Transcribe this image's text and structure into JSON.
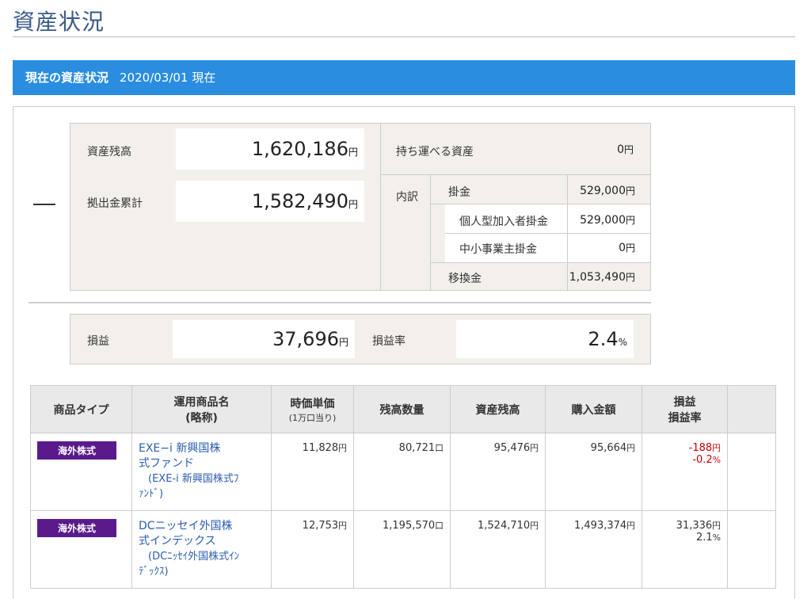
{
  "page_title": "資産状況",
  "section": {
    "title": "現在の資産状況",
    "date": "2020/03/01 現在"
  },
  "summary": {
    "collapse_icon": "minus-icon",
    "asset_balance": {
      "label": "資産残高",
      "value": "1,620,186",
      "unit": "円"
    },
    "contribution_total": {
      "label": "拠出金累計",
      "value": "1,582,490",
      "unit": "円"
    },
    "portable_assets": {
      "label": "持ち運べる資産",
      "value": "0",
      "unit": "円"
    },
    "breakdown_label": "内訳",
    "breakdown": [
      {
        "label": "掛金",
        "value": "529,000",
        "unit": "円"
      },
      {
        "label": "個人型加入者掛金",
        "value": "529,000",
        "unit": "円"
      },
      {
        "label": "中小事業主掛金",
        "value": "0",
        "unit": "円"
      },
      {
        "label": "移換金",
        "value": "1,053,490",
        "unit": "円"
      }
    ],
    "profit": {
      "label": "損益",
      "value": "37,696",
      "unit": "円"
    },
    "profit_rate": {
      "label": "損益率",
      "value": "2.4",
      "unit": "%"
    }
  },
  "table": {
    "headers": [
      {
        "main": "商品タイプ",
        "sub": ""
      },
      {
        "main": "運用商品名",
        "sub": "(略称)"
      },
      {
        "main": "時価単価",
        "sub": "(1万口当り)"
      },
      {
        "main": "残高数量",
        "sub": ""
      },
      {
        "main": "資産残高",
        "sub": ""
      },
      {
        "main": "購入金額",
        "sub": ""
      },
      {
        "main": "損益",
        "sub": "損益率"
      }
    ],
    "rows": [
      {
        "type": "海外株式",
        "name_line1": "EXE−i 新興国株",
        "name_line2": "式ファンド",
        "short_line1": "(EXE-i 新興国株式ﾌ",
        "short_line2": "ｧﾝﾄﾞ)",
        "price": "11,828",
        "price_unit": "円",
        "qty": "80,721",
        "qty_unit": "口",
        "balance": "95,476",
        "balance_unit": "円",
        "purchase": "95,664",
        "purchase_unit": "円",
        "pl": "-188",
        "pl_unit": "円",
        "pl_rate": "-0.2",
        "pl_rate_unit": "%",
        "negative": true
      },
      {
        "type": "海外株式",
        "name_line1": "DCニッセイ外国株",
        "name_line2": "式インデックス",
        "short_line1": "(DCﾆｯｾｲ外国株式ｲﾝ",
        "short_line2": "ﾃﾞｯｸｽ)",
        "price": "12,753",
        "price_unit": "円",
        "qty": "1,195,570",
        "qty_unit": "口",
        "balance": "1,524,710",
        "balance_unit": "円",
        "purchase": "1,493,374",
        "purchase_unit": "円",
        "pl": "31,336",
        "pl_unit": "円",
        "pl_rate": "2.1",
        "pl_rate_unit": "%",
        "negative": false
      }
    ]
  }
}
